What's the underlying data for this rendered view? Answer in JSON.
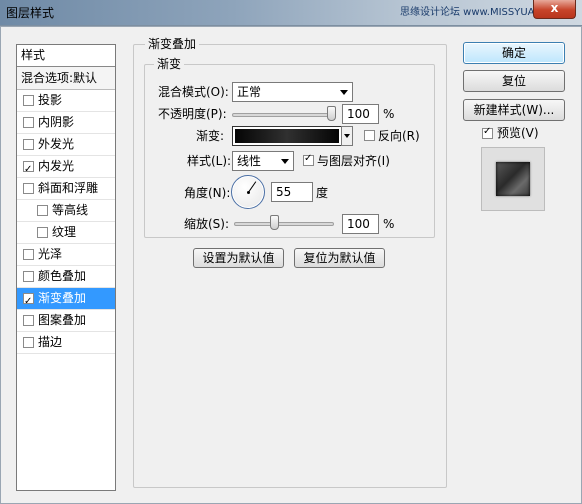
{
  "window": {
    "title": "图层样式",
    "watermark": "思缘设计论坛 www.MISSYUAN.COM",
    "close_label": "x"
  },
  "style_list": {
    "header": "样式",
    "blend_options": "混合选项:默认",
    "items": [
      {
        "label": "投影",
        "checked": false,
        "sub": false,
        "active": false
      },
      {
        "label": "内阴影",
        "checked": false,
        "sub": false,
        "active": false
      },
      {
        "label": "外发光",
        "checked": false,
        "sub": false,
        "active": false
      },
      {
        "label": "内发光",
        "checked": true,
        "sub": false,
        "active": false
      },
      {
        "label": "斜面和浮雕",
        "checked": false,
        "sub": false,
        "active": false
      },
      {
        "label": "等高线",
        "checked": false,
        "sub": true,
        "active": false
      },
      {
        "label": "纹理",
        "checked": false,
        "sub": true,
        "active": false
      },
      {
        "label": "光泽",
        "checked": false,
        "sub": false,
        "active": false
      },
      {
        "label": "颜色叠加",
        "checked": false,
        "sub": false,
        "active": false
      },
      {
        "label": "渐变叠加",
        "checked": true,
        "sub": false,
        "active": true
      },
      {
        "label": "图案叠加",
        "checked": false,
        "sub": false,
        "active": false
      },
      {
        "label": "描边",
        "checked": false,
        "sub": false,
        "active": false
      }
    ]
  },
  "panel": {
    "outer_title": "渐变叠加",
    "inner_title": "渐变",
    "blend_mode_label": "混合模式(O):",
    "blend_mode_value": "正常",
    "opacity_label": "不透明度(P):",
    "opacity_value": "100",
    "opacity_percent": 1.0,
    "percent_sign": "%",
    "gradient_label": "渐变:",
    "reverse_label": "反向(R)",
    "reverse_checked": false,
    "style_label": "样式(L):",
    "style_value": "线性",
    "align_label": "与图层对齐(I)",
    "align_checked": true,
    "angle_label": "角度(N):",
    "angle_value": "55",
    "angle_unit": "度",
    "scale_label": "缩放(S):",
    "scale_value": "100",
    "scale_percent": 0.4,
    "set_default_label": "设置为默认值",
    "reset_default_label": "复位为默认值"
  },
  "buttons": {
    "ok": "确定",
    "reset": "复位",
    "new_style": "新建样式(W)...",
    "preview_label": "预览(V)",
    "preview_checked": true
  }
}
